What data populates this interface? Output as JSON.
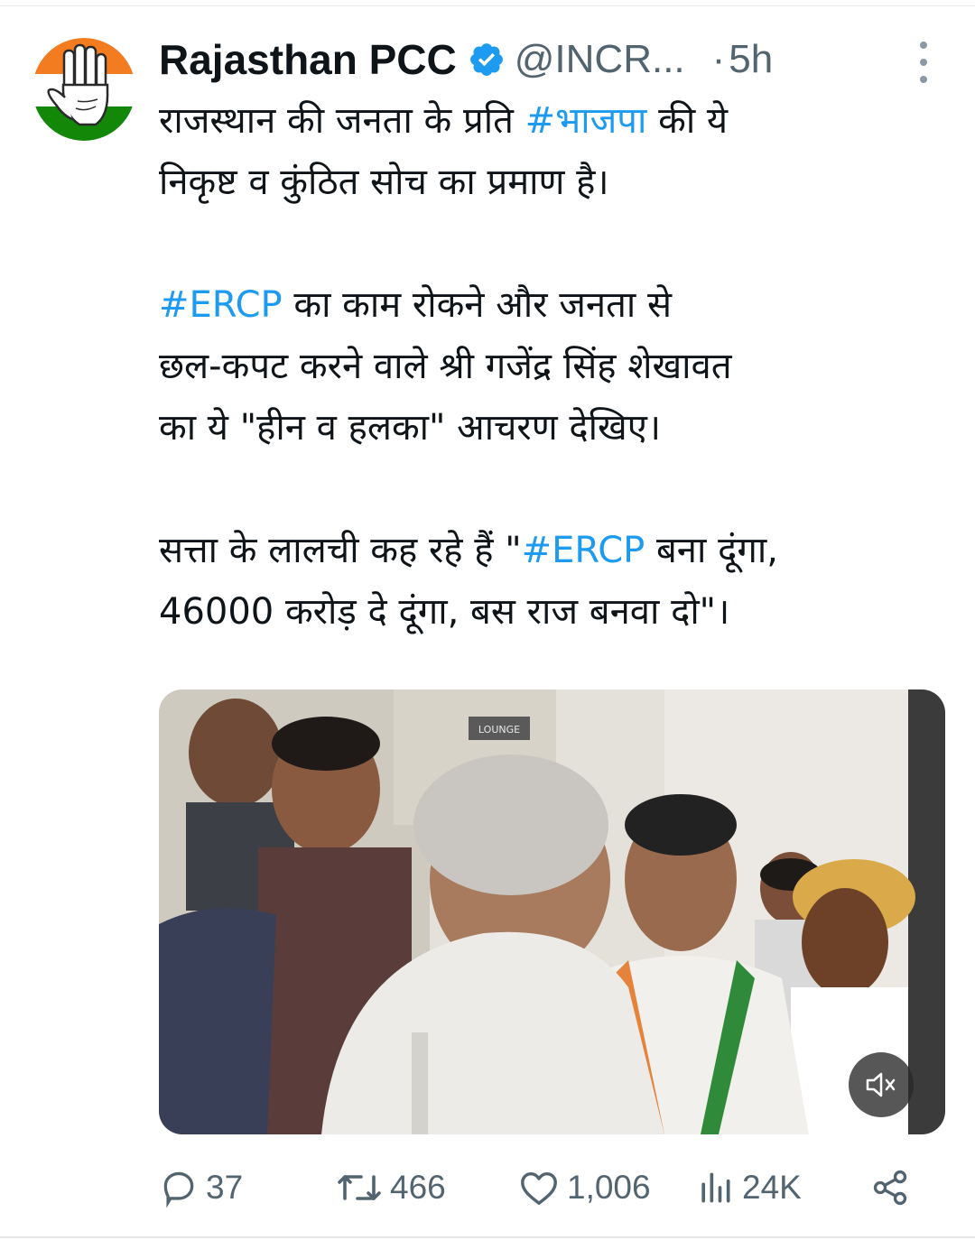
{
  "tweet": {
    "display_name": "Rajasthan PCC",
    "handle": "@INCR...",
    "separator": "·",
    "time": "5h",
    "text": {
      "p1_a": "राजस्थान की जनता के प्रति ",
      "p1_tag": "#भाजपा",
      "p1_b": " की ये",
      "p1_line2": "निकृष्ट व कुंठित सोच का प्रमाण है।",
      "p2_tag": "#ERCP",
      "p2_a": " का काम रोकने और जनता से",
      "p2_line2": "छल-कपट करने वाले श्री गजेंद्र सिंह शेखावत",
      "p2_line3": "का ये \"हीन व हलका\" आचरण देखिए।",
      "p3_a": "सत्ता के लालची कह रहे हैं \"",
      "p3_tag": "#ERCP",
      "p3_b": " बना दूंगा,",
      "p3_line2": "46000 करोड़ दे दूंगा, बस राज बनवा दो\"।"
    },
    "media": {
      "sign_text": "LOUNGE",
      "mute_icon": "speaker-muted-icon"
    },
    "actions": {
      "replies": "37",
      "reposts": "466",
      "likes": "1,006",
      "views": "24K"
    }
  },
  "colors": {
    "hashtag": "#1d9bf0",
    "verified": "#1d9bf0",
    "secondary_text": "#536471",
    "saffron": "#f47c20",
    "green": "#138808"
  }
}
